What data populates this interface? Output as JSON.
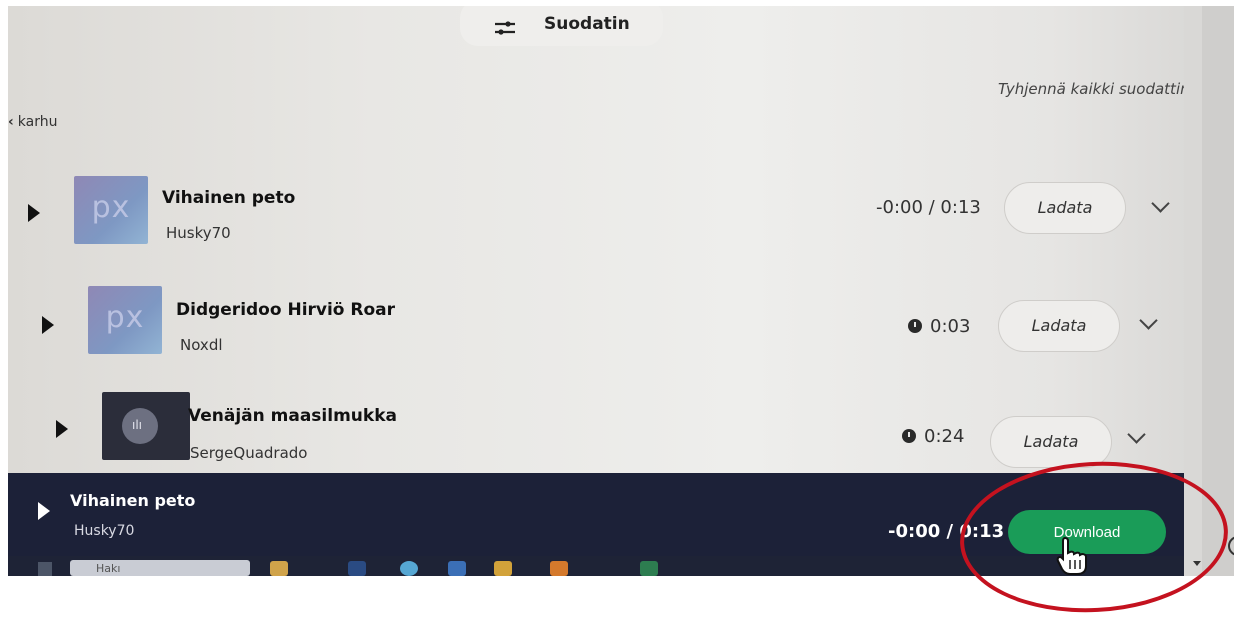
{
  "header": {
    "filter_label": "Suodatin",
    "clear_filters": "Tyhjennä kaikki suodattimet"
  },
  "breadcrumb": {
    "back_label": "karhu"
  },
  "tracks": [
    {
      "title": "Vihainen peto",
      "artist": "Husky70",
      "duration": "-0:00 / 0:13",
      "thumb_text": "px",
      "button": "Ladata"
    },
    {
      "title": "Didgeridoo Hirviö Roar",
      "artist": "Noxdl",
      "duration": "0:03",
      "thumb_text": "px",
      "button": "Ladata"
    },
    {
      "title": "Venäjän maasilmukka",
      "artist": "SergeQuadrado",
      "duration": "0:24",
      "button": "Ladata"
    }
  ],
  "player": {
    "title": "Vihainen peto",
    "artist": "Husky70",
    "time": "-0:00 / 0:13",
    "download_label": "Download"
  },
  "taskbar": {
    "search_text": "Hakı"
  },
  "colors": {
    "player_bg": "#1c2138",
    "download_green": "#1a9c58",
    "annotation_red": "#c4121f"
  }
}
